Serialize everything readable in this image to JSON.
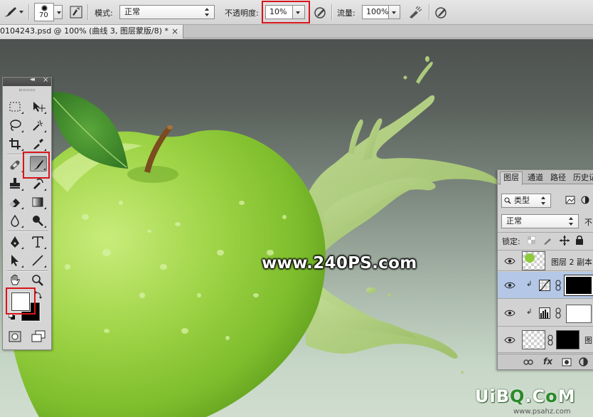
{
  "options_bar": {
    "brush_size": "70",
    "mode_label": "模式:",
    "mode_value": "正常",
    "opacity_label": "不透明度:",
    "opacity_value": "10%",
    "flow_label": "流量:",
    "flow_value": "100%"
  },
  "document_tab": {
    "title": "0104243.psd @ 100% (曲线 3, 图层蒙版/8) *",
    "close_glyph": "×"
  },
  "canvas": {
    "watermark": "www.240PS.com",
    "logo_parts": [
      "UiB",
      "Q",
      ".C",
      "o",
      "M"
    ],
    "logo_site": "www.psahz.com"
  },
  "tools_panel": {
    "collapse_glyph": "◂◂",
    "close_glyph": "×",
    "highlight_color": "#d8141b"
  },
  "layers_panel": {
    "tabs": [
      "图层",
      "通道",
      "路径",
      "历史记"
    ],
    "filter_label": "类型",
    "blend_mode": "正常",
    "opacity_short": "不",
    "lock_label": "锁定:",
    "layers": [
      {
        "name": "图层 2 副本",
        "selected": false
      },
      {
        "name": "",
        "selected": true
      },
      {
        "name": "",
        "selected": false
      },
      {
        "name": "图",
        "selected": false
      }
    ],
    "selected_color": "#b4c7e6"
  }
}
